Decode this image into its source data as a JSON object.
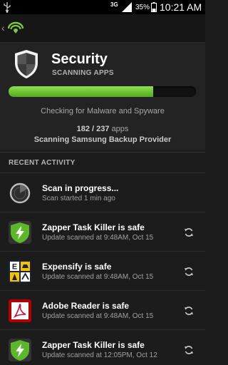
{
  "status_bar": {
    "network_label": "3G",
    "battery_label": "35%",
    "battery_level": 0.35,
    "time": "10:21 AM"
  },
  "action_bar": {
    "back_icon": "chevron-left-icon",
    "logo_icon": "lookout-logo-icon"
  },
  "scan": {
    "title": "Security",
    "subtitle": "SCANNING APPS",
    "progress_fraction": 0.77,
    "checking_text": "Checking for Malware and Spyware",
    "scanned_count": "182 / 237",
    "count_suffix": "apps",
    "current_app": "Scanning Samsung Backup Provider",
    "shield_icon": "security-shield-icon"
  },
  "recent_activity": {
    "heading": "RECENT ACTIVITY",
    "items": [
      {
        "title": "Scan in progress...",
        "subtitle": "Scan started 1 min ago",
        "icon": "scan-radar-icon",
        "has_action": false
      },
      {
        "title": "Zapper Task Killer is safe",
        "subtitle": "Update scanned at 9:48AM, Oct 15",
        "icon": "zapper-icon",
        "has_action": true
      },
      {
        "title": "Expensify is safe",
        "subtitle": "Update scanned at 9:48AM, Oct 15",
        "icon": "expensify-icon",
        "has_action": true
      },
      {
        "title": "Adobe Reader is safe",
        "subtitle": "Update scanned at 9:48AM, Oct 15",
        "icon": "adobe-reader-icon",
        "has_action": true
      },
      {
        "title": "Zapper Task Killer is safe",
        "subtitle": "Update scanned at 12:05PM, Oct 12",
        "icon": "zapper-icon",
        "has_action": true
      }
    ]
  },
  "colors": {
    "progress_green": "#6cc232",
    "accent_green": "#7ec843"
  }
}
